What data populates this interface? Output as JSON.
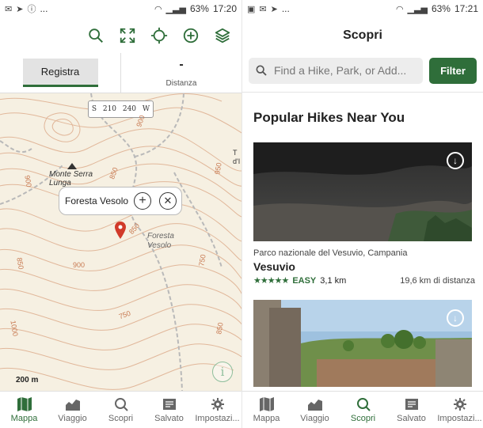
{
  "left": {
    "status": {
      "time": "17:20",
      "battery": "63%",
      "extra": "..."
    },
    "record_label": "Registra",
    "distance_value": "-",
    "distance_label": "Distanza",
    "compass": [
      "S",
      "210",
      "240",
      "W"
    ],
    "map_labels": {
      "peak": "Monte Serra Lunga",
      "forest": "Foresta Vesolo",
      "edge": "T d'I"
    },
    "contour_numbers": [
      "900",
      "950",
      "850",
      "900",
      "850",
      "750",
      "750",
      "850",
      "1000",
      "900",
      "850"
    ],
    "popup_title": "Foresta Vesolo",
    "scale_label": "200 m",
    "info_glyph": "i"
  },
  "right": {
    "status": {
      "time": "17:21",
      "battery": "63%",
      "extra": "..."
    },
    "header_title": "Scopri",
    "search_placeholder": "Find a Hike, Park, or Add...",
    "filter_label": "Filter",
    "section_title": "Popular Hikes Near You",
    "hike": {
      "region": "Parco nazionale del Vesuvio, Campania",
      "name": "Vesuvio",
      "stars": "★★★★★",
      "rating": 5,
      "difficulty": "EASY",
      "length": "3,1 km",
      "distance": "19,6 km di distanza"
    }
  },
  "nav": [
    {
      "label": "Mappa",
      "icon": "map-icon"
    },
    {
      "label": "Viaggio",
      "icon": "chart-icon"
    },
    {
      "label": "Scopri",
      "icon": "search-icon"
    },
    {
      "label": "Salvato",
      "icon": "saved-icon"
    },
    {
      "label": "Impostazi...",
      "icon": "gear-icon"
    }
  ],
  "colors": {
    "accent": "#2f6e3a",
    "pin": "#d13a2a",
    "map_bg": "#f6f0e2",
    "contour": "#e1b79a",
    "track": "#b9b9b9"
  }
}
